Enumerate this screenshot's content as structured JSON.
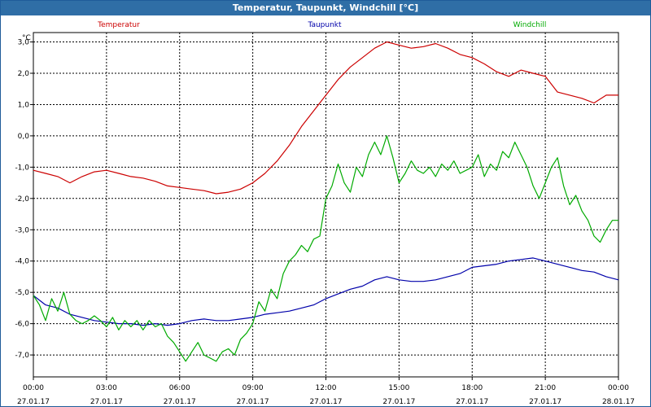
{
  "window": {
    "title": "Temperatur, Taupunkt, Windchill [°C]"
  },
  "chart_data": {
    "type": "line",
    "title": "Temperatur, Taupunkt, Windchill [°C]",
    "ylabel": "°C",
    "ylim": [
      -7.7,
      3.3
    ],
    "xlim": [
      0,
      24
    ],
    "grid": true,
    "legend_placement": "top",
    "y_ticks": [
      {
        "value": 3.0,
        "label": "3,0"
      },
      {
        "value": 2.0,
        "label": "2,0"
      },
      {
        "value": 1.0,
        "label": "1,0"
      },
      {
        "value": 0.0,
        "label": "0,0"
      },
      {
        "value": -1.0,
        "label": "-1,0"
      },
      {
        "value": -2.0,
        "label": "-2,0"
      },
      {
        "value": -3.0,
        "label": "-3,0"
      },
      {
        "value": -4.0,
        "label": "-4,0"
      },
      {
        "value": -5.0,
        "label": "-5,0"
      },
      {
        "value": -6.0,
        "label": "-6,0"
      },
      {
        "value": -7.0,
        "label": "-7,0"
      }
    ],
    "x_ticks": [
      {
        "value": 0,
        "time": "00:00",
        "date": "27.01.17"
      },
      {
        "value": 3,
        "time": "03:00",
        "date": "27.01.17"
      },
      {
        "value": 6,
        "time": "06:00",
        "date": "27.01.17"
      },
      {
        "value": 9,
        "time": "09:00",
        "date": "27.01.17"
      },
      {
        "value": 12,
        "time": "12:00",
        "date": "27.01.17"
      },
      {
        "value": 15,
        "time": "15:00",
        "date": "27.01.17"
      },
      {
        "value": 18,
        "time": "18:00",
        "date": "27.01.17"
      },
      {
        "value": 21,
        "time": "21:00",
        "date": "27.01.17"
      },
      {
        "value": 24,
        "time": "00:00",
        "date": "28.01.17"
      }
    ],
    "series": [
      {
        "name": "Temperatur",
        "color": "#cc0000",
        "points": [
          [
            0,
            -1.1
          ],
          [
            0.5,
            -1.2
          ],
          [
            1,
            -1.3
          ],
          [
            1.5,
            -1.5
          ],
          [
            2,
            -1.3
          ],
          [
            2.5,
            -1.15
          ],
          [
            3,
            -1.1
          ],
          [
            3.5,
            -1.2
          ],
          [
            4,
            -1.3
          ],
          [
            4.5,
            -1.35
          ],
          [
            5,
            -1.45
          ],
          [
            5.5,
            -1.6
          ],
          [
            6,
            -1.65
          ],
          [
            6.5,
            -1.7
          ],
          [
            7,
            -1.75
          ],
          [
            7.5,
            -1.85
          ],
          [
            8,
            -1.8
          ],
          [
            8.5,
            -1.7
          ],
          [
            9,
            -1.5
          ],
          [
            9.5,
            -1.2
          ],
          [
            10,
            -0.8
          ],
          [
            10.5,
            -0.3
          ],
          [
            11,
            0.3
          ],
          [
            11.5,
            0.8
          ],
          [
            12,
            1.3
          ],
          [
            12.5,
            1.8
          ],
          [
            13,
            2.2
          ],
          [
            13.5,
            2.5
          ],
          [
            14,
            2.8
          ],
          [
            14.5,
            3.0
          ],
          [
            15,
            2.9
          ],
          [
            15.5,
            2.8
          ],
          [
            16,
            2.85
          ],
          [
            16.5,
            2.95
          ],
          [
            17,
            2.8
          ],
          [
            17.5,
            2.6
          ],
          [
            18,
            2.5
          ],
          [
            18.5,
            2.3
          ],
          [
            19,
            2.05
          ],
          [
            19.5,
            1.9
          ],
          [
            20,
            2.1
          ],
          [
            20.5,
            2.0
          ],
          [
            21,
            1.9
          ],
          [
            21.5,
            1.4
          ],
          [
            22,
            1.3
          ],
          [
            22.5,
            1.2
          ],
          [
            23,
            1.05
          ],
          [
            23.5,
            1.3
          ],
          [
            24,
            1.3
          ]
        ]
      },
      {
        "name": "Taupunkt",
        "color": "#0000aa",
        "points": [
          [
            0,
            -5.1
          ],
          [
            0.5,
            -5.4
          ],
          [
            1,
            -5.5
          ],
          [
            1.5,
            -5.7
          ],
          [
            2,
            -5.8
          ],
          [
            2.5,
            -5.9
          ],
          [
            3,
            -5.95
          ],
          [
            3.5,
            -6.0
          ],
          [
            4,
            -6.0
          ],
          [
            4.5,
            -6.05
          ],
          [
            5,
            -6.0
          ],
          [
            5.5,
            -6.05
          ],
          [
            6,
            -6.0
          ],
          [
            6.5,
            -5.9
          ],
          [
            7,
            -5.85
          ],
          [
            7.5,
            -5.9
          ],
          [
            8,
            -5.9
          ],
          [
            8.5,
            -5.85
          ],
          [
            9,
            -5.8
          ],
          [
            9.5,
            -5.7
          ],
          [
            10,
            -5.65
          ],
          [
            10.5,
            -5.6
          ],
          [
            11,
            -5.5
          ],
          [
            11.5,
            -5.4
          ],
          [
            12,
            -5.2
          ],
          [
            12.5,
            -5.05
          ],
          [
            13,
            -4.9
          ],
          [
            13.5,
            -4.8
          ],
          [
            14,
            -4.6
          ],
          [
            14.5,
            -4.5
          ],
          [
            15,
            -4.6
          ],
          [
            15.5,
            -4.65
          ],
          [
            16,
            -4.65
          ],
          [
            16.5,
            -4.6
          ],
          [
            17,
            -4.5
          ],
          [
            17.5,
            -4.4
          ],
          [
            18,
            -4.2
          ],
          [
            18.5,
            -4.15
          ],
          [
            19,
            -4.1
          ],
          [
            19.5,
            -4.0
          ],
          [
            20,
            -3.95
          ],
          [
            20.5,
            -3.9
          ],
          [
            21,
            -4.0
          ],
          [
            21.5,
            -4.1
          ],
          [
            22,
            -4.2
          ],
          [
            22.5,
            -4.3
          ],
          [
            23,
            -4.35
          ],
          [
            23.5,
            -4.5
          ],
          [
            24,
            -4.6
          ]
        ]
      },
      {
        "name": "Windchill",
        "color": "#00aa00",
        "points": [
          [
            0,
            -5.1
          ],
          [
            0.25,
            -5.4
          ],
          [
            0.5,
            -5.9
          ],
          [
            0.75,
            -5.2
          ],
          [
            1,
            -5.6
          ],
          [
            1.25,
            -5.0
          ],
          [
            1.5,
            -5.7
          ],
          [
            1.75,
            -5.9
          ],
          [
            2,
            -6.0
          ],
          [
            2.25,
            -5.9
          ],
          [
            2.5,
            -5.75
          ],
          [
            2.75,
            -5.9
          ],
          [
            3,
            -6.1
          ],
          [
            3.25,
            -5.8
          ],
          [
            3.5,
            -6.2
          ],
          [
            3.75,
            -5.9
          ],
          [
            4,
            -6.1
          ],
          [
            4.25,
            -5.9
          ],
          [
            4.5,
            -6.2
          ],
          [
            4.75,
            -5.9
          ],
          [
            5,
            -6.1
          ],
          [
            5.25,
            -6.0
          ],
          [
            5.5,
            -6.4
          ],
          [
            5.75,
            -6.6
          ],
          [
            6,
            -6.9
          ],
          [
            6.25,
            -7.2
          ],
          [
            6.5,
            -6.9
          ],
          [
            6.75,
            -6.6
          ],
          [
            7,
            -7.0
          ],
          [
            7.25,
            -7.1
          ],
          [
            7.5,
            -7.2
          ],
          [
            7.75,
            -6.9
          ],
          [
            8,
            -6.8
          ],
          [
            8.25,
            -7.0
          ],
          [
            8.5,
            -6.5
          ],
          [
            8.75,
            -6.3
          ],
          [
            9,
            -6.0
          ],
          [
            9.25,
            -5.3
          ],
          [
            9.5,
            -5.6
          ],
          [
            9.75,
            -4.9
          ],
          [
            10,
            -5.2
          ],
          [
            10.25,
            -4.4
          ],
          [
            10.5,
            -4.0
          ],
          [
            10.75,
            -3.8
          ],
          [
            11,
            -3.5
          ],
          [
            11.25,
            -3.7
          ],
          [
            11.5,
            -3.3
          ],
          [
            11.75,
            -3.2
          ],
          [
            12,
            -2.0
          ],
          [
            12.25,
            -1.6
          ],
          [
            12.5,
            -0.9
          ],
          [
            12.75,
            -1.5
          ],
          [
            13,
            -1.8
          ],
          [
            13.25,
            -1.0
          ],
          [
            13.5,
            -1.3
          ],
          [
            13.75,
            -0.6
          ],
          [
            14,
            -0.2
          ],
          [
            14.25,
            -0.6
          ],
          [
            14.5,
            0.0
          ],
          [
            14.75,
            -0.7
          ],
          [
            15,
            -1.5
          ],
          [
            15.25,
            -1.2
          ],
          [
            15.5,
            -0.8
          ],
          [
            15.75,
            -1.1
          ],
          [
            16,
            -1.2
          ],
          [
            16.25,
            -1.0
          ],
          [
            16.5,
            -1.3
          ],
          [
            16.75,
            -0.9
          ],
          [
            17,
            -1.1
          ],
          [
            17.25,
            -0.8
          ],
          [
            17.5,
            -1.2
          ],
          [
            17.75,
            -1.1
          ],
          [
            18,
            -1.0
          ],
          [
            18.25,
            -0.6
          ],
          [
            18.5,
            -1.3
          ],
          [
            18.75,
            -0.9
          ],
          [
            19,
            -1.1
          ],
          [
            19.25,
            -0.5
          ],
          [
            19.5,
            -0.7
          ],
          [
            19.75,
            -0.2
          ],
          [
            20,
            -0.6
          ],
          [
            20.25,
            -1.0
          ],
          [
            20.5,
            -1.6
          ],
          [
            20.75,
            -2.0
          ],
          [
            21,
            -1.5
          ],
          [
            21.25,
            -1.0
          ],
          [
            21.5,
            -0.7
          ],
          [
            21.75,
            -1.6
          ],
          [
            22,
            -2.2
          ],
          [
            22.25,
            -1.9
          ],
          [
            22.5,
            -2.4
          ],
          [
            22.75,
            -2.7
          ],
          [
            23,
            -3.2
          ],
          [
            23.25,
            -3.4
          ],
          [
            23.5,
            -3.0
          ],
          [
            23.75,
            -2.7
          ],
          [
            24,
            -2.7
          ]
        ]
      }
    ]
  }
}
